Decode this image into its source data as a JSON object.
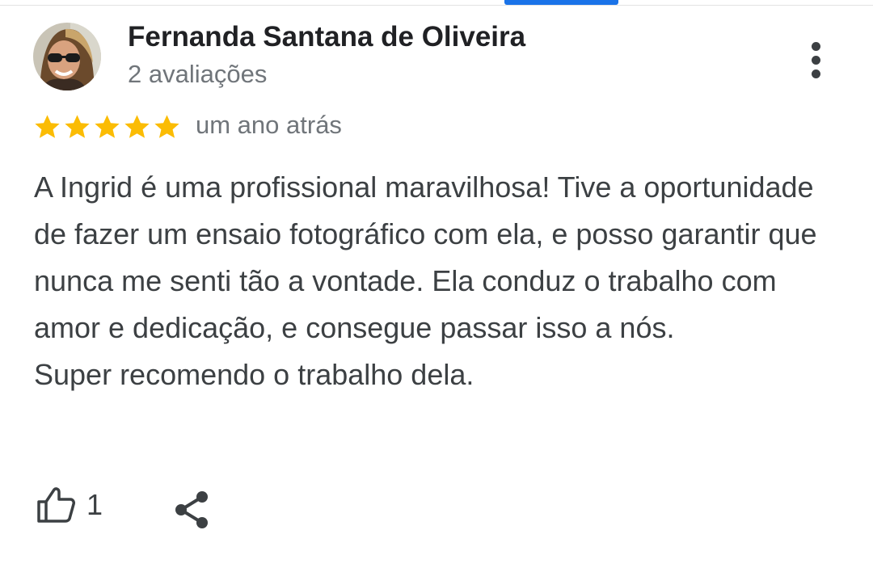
{
  "review": {
    "author_name": "Fernanda Santana de Oliveira",
    "author_meta": "2 avaliações",
    "rating": 5,
    "rating_max": 5,
    "time": "um ano atrás",
    "text_paragraphs": [
      "A Ingrid é uma profissional maravilhosa! Tive a oportunidade de fazer um ensaio fotográfico com ela, e posso garantir que nunca me senti tão a vontade. Ela conduz o trabalho com amor e dedicação, e consegue passar isso a nós.",
      "Super recomendo o trabalho dela."
    ],
    "like_count": "1"
  },
  "icons": {
    "more": "more-vert-icon",
    "like": "thumb-up-icon",
    "share": "share-icon",
    "star": "star-icon"
  },
  "colors": {
    "star": "#fbbc04",
    "accent": "#1a73e8",
    "name": "#202124",
    "body_text": "#3c4043",
    "secondary_text": "#70757a"
  }
}
